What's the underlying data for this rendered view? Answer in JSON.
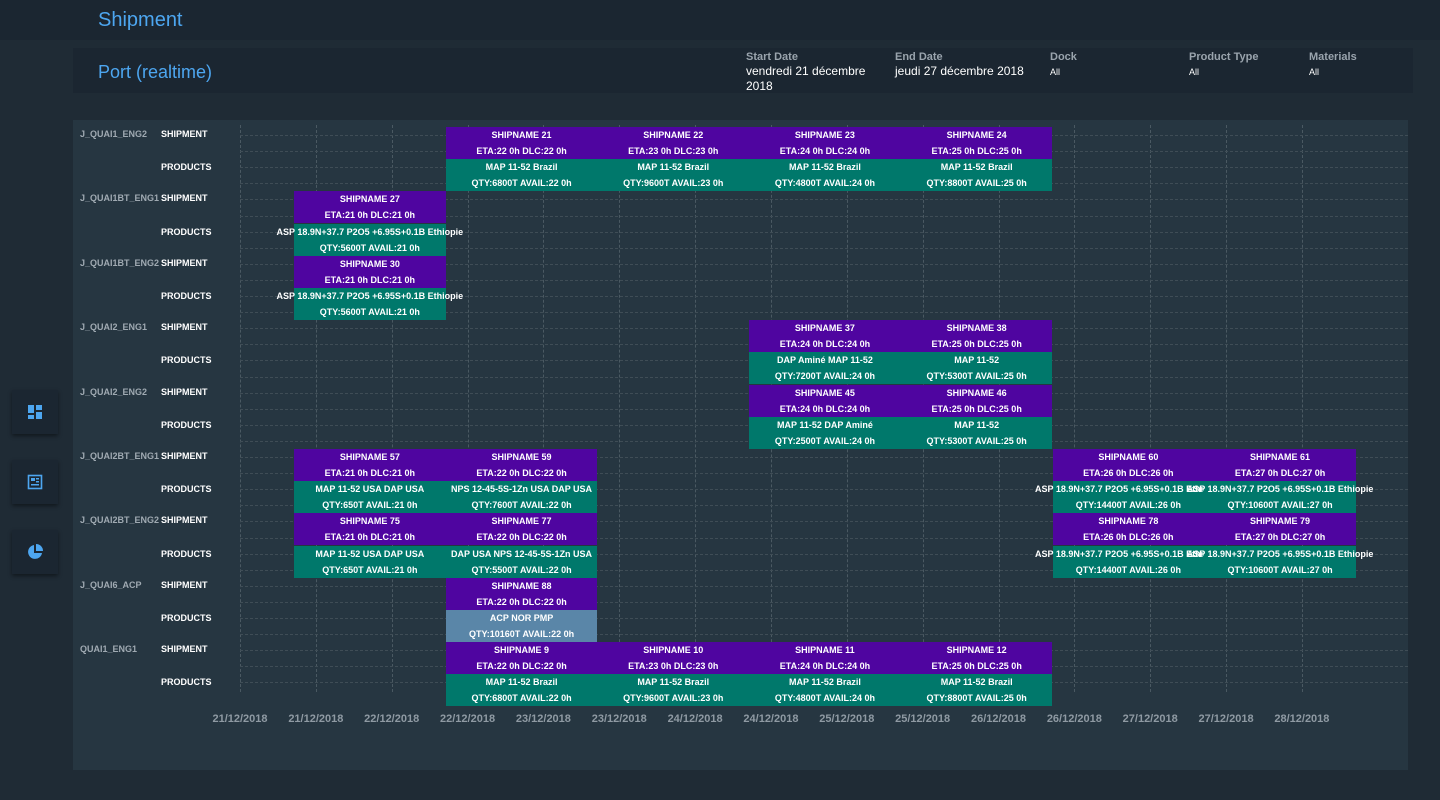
{
  "app": {
    "title": "Shipment"
  },
  "header": {
    "title": "Port (realtime)",
    "filters": {
      "start_date": {
        "label": "Start Date",
        "value": "vendredi 21 décembre 2018"
      },
      "end_date": {
        "label": "End Date",
        "value": "jeudi 27 décembre 2018"
      },
      "dock": {
        "label": "Dock",
        "value": "All"
      },
      "product_type": {
        "label": "Product Type",
        "value": "All"
      },
      "materials": {
        "label": "Materials",
        "value": "All"
      }
    }
  },
  "sidebar": {
    "items": [
      {
        "icon": "dashboard-icon"
      },
      {
        "icon": "report-icon"
      },
      {
        "icon": "pie-chart-icon"
      }
    ]
  },
  "colors": {
    "shipment": "#4f05a0",
    "products": "#00786b",
    "acp": "#5a86a8",
    "accent": "#4da6f0"
  },
  "timeline": {
    "row_labels": {
      "shipment": "SHIPMENT",
      "products": "PRODUCTS"
    },
    "x_ticks": [
      "21/12/2018",
      "21/12/2018",
      "22/12/2018",
      "22/12/2018",
      "23/12/2018",
      "23/12/2018",
      "24/12/2018",
      "24/12/2018",
      "25/12/2018",
      "25/12/2018",
      "26/12/2018",
      "26/12/2018",
      "27/12/2018",
      "27/12/2018",
      "28/12/2018"
    ],
    "docks": [
      {
        "name": "J_QUAI1_ENG2",
        "shipments": [
          {
            "start": 2,
            "end": 3,
            "name": "SHIPNAME 21",
            "eta": "ETA:22 0h DLC:22 0h"
          },
          {
            "start": 3,
            "end": 4,
            "name": "SHIPNAME 22",
            "eta": "ETA:23 0h DLC:23 0h"
          },
          {
            "start": 4,
            "end": 5,
            "name": "SHIPNAME 23",
            "eta": "ETA:24 0h DLC:24 0h"
          },
          {
            "start": 5,
            "end": 6,
            "name": "SHIPNAME 24",
            "eta": "ETA:25 0h DLC:25 0h"
          }
        ],
        "products": [
          {
            "start": 2,
            "end": 3,
            "type": "prod",
            "name": "MAP 11-52  Brazil",
            "qty": "QTY:6800T AVAIL:22 0h"
          },
          {
            "start": 3,
            "end": 4,
            "type": "prod",
            "name": "MAP 11-52  Brazil",
            "qty": "QTY:9600T AVAIL:23 0h"
          },
          {
            "start": 4,
            "end": 5,
            "type": "prod",
            "name": "MAP 11-52  Brazil",
            "qty": "QTY:4800T AVAIL:24 0h"
          },
          {
            "start": 5,
            "end": 6,
            "type": "prod",
            "name": "MAP 11-52  Brazil",
            "qty": "QTY:8800T AVAIL:25 0h"
          }
        ]
      },
      {
        "name": "J_QUAI1BT_ENG1",
        "shipments": [
          {
            "start": 1,
            "end": 2,
            "name": "SHIPNAME 27",
            "eta": "ETA:21 0h DLC:21 0h"
          }
        ],
        "products": [
          {
            "start": 1,
            "end": 2,
            "type": "prod",
            "name": "ASP 18.9N+37.7 P2O5 +6.95S+0.1B  Ethiopie",
            "qty": "QTY:5600T AVAIL:21 0h"
          }
        ]
      },
      {
        "name": "J_QUAI1BT_ENG2",
        "shipments": [
          {
            "start": 1,
            "end": 2,
            "name": "SHIPNAME 30",
            "eta": "ETA:21 0h DLC:21 0h"
          }
        ],
        "products": [
          {
            "start": 1,
            "end": 2,
            "type": "prod",
            "name": "ASP 18.9N+37.7 P2O5 +6.95S+0.1B  Ethiopie",
            "qty": "QTY:5600T AVAIL:21 0h"
          }
        ]
      },
      {
        "name": "J_QUAI2_ENG1",
        "shipments": [
          {
            "start": 4,
            "end": 5,
            "name": "SHIPNAME 37",
            "eta": "ETA:24 0h DLC:24 0h"
          },
          {
            "start": 5,
            "end": 6,
            "name": "SHIPNAME 38",
            "eta": "ETA:25 0h DLC:25 0h"
          }
        ],
        "products": [
          {
            "start": 4,
            "end": 5,
            "type": "prod",
            "name": "DAP Aminé          MAP 11-52",
            "qty": "QTY:7200T AVAIL:24 0h"
          },
          {
            "start": 5,
            "end": 6,
            "type": "prod",
            "name": "MAP 11-52",
            "qty": "QTY:5300T AVAIL:25 0h"
          }
        ]
      },
      {
        "name": "J_QUAI2_ENG2",
        "shipments": [
          {
            "start": 4,
            "end": 5,
            "name": "SHIPNAME 45",
            "eta": "ETA:24 0h DLC:24 0h"
          },
          {
            "start": 5,
            "end": 6,
            "name": "SHIPNAME 46",
            "eta": "ETA:25 0h DLC:25 0h"
          }
        ],
        "products": [
          {
            "start": 4,
            "end": 5,
            "type": "prod",
            "name": "MAP 11-52          DAP Aminé",
            "qty": "QTY:2500T AVAIL:24 0h"
          },
          {
            "start": 5,
            "end": 6,
            "type": "prod",
            "name": "MAP 11-52",
            "qty": "QTY:5300T AVAIL:25 0h"
          }
        ]
      },
      {
        "name": "J_QUAI2BT_ENG1",
        "shipments": [
          {
            "start": 1,
            "end": 2,
            "name": "SHIPNAME 57",
            "eta": "ETA:21 0h DLC:21 0h"
          },
          {
            "start": 2,
            "end": 3,
            "name": "SHIPNAME 59",
            "eta": "ETA:22 0h DLC:22 0h"
          },
          {
            "start": 6,
            "end": 7,
            "name": "SHIPNAME 60",
            "eta": "ETA:26 0h DLC:26 0h"
          },
          {
            "start": 7,
            "end": 8,
            "name": "SHIPNAME 61",
            "eta": "ETA:27 0h DLC:27 0h"
          }
        ],
        "products": [
          {
            "start": 1,
            "end": 2,
            "type": "prod",
            "name": "MAP 11-52 USA        DAP USA",
            "qty": "QTY:650T AVAIL:21 0h"
          },
          {
            "start": 2,
            "end": 3,
            "type": "prod",
            "name": "NPS 12-45-5S-1Zn USA    DAP USA",
            "qty": "QTY:7600T AVAIL:22 0h"
          },
          {
            "start": 6,
            "end": 7,
            "type": "prod",
            "name": "ASP 18.9N+37.7 P2O5 +6.95S+0.1B  Ethiopie",
            "qty": "QTY:14400T AVAIL:26 0h"
          },
          {
            "start": 7,
            "end": 8,
            "type": "prod",
            "name": "ASP 18.9N+37.7 P2O5 +6.95S+0.1B  Ethiopie",
            "qty": "QTY:10600T AVAIL:27 0h"
          }
        ]
      },
      {
        "name": "J_QUAI2BT_ENG2",
        "shipments": [
          {
            "start": 1,
            "end": 2,
            "name": "SHIPNAME 75",
            "eta": "ETA:21 0h DLC:21 0h"
          },
          {
            "start": 2,
            "end": 3,
            "name": "SHIPNAME 77",
            "eta": "ETA:22 0h DLC:22 0h"
          },
          {
            "start": 6,
            "end": 7,
            "name": "SHIPNAME 78",
            "eta": "ETA:26 0h DLC:26 0h"
          },
          {
            "start": 7,
            "end": 8,
            "name": "SHIPNAME 79",
            "eta": "ETA:27 0h DLC:27 0h"
          }
        ],
        "products": [
          {
            "start": 1,
            "end": 2,
            "type": "prod",
            "name": "MAP 11-52 USA        DAP USA",
            "qty": "QTY:650T AVAIL:21 0h"
          },
          {
            "start": 2,
            "end": 3,
            "type": "prod",
            "name": "DAP USA    NPS 12-45-5S-1Zn USA",
            "qty": "QTY:5500T AVAIL:22 0h"
          },
          {
            "start": 6,
            "end": 7,
            "type": "prod",
            "name": "ASP 18.9N+37.7 P2O5 +6.95S+0.1B  Ethiopie",
            "qty": "QTY:14400T AVAIL:26 0h"
          },
          {
            "start": 7,
            "end": 8,
            "type": "prod",
            "name": "ASP 18.9N+37.7 P2O5 +6.95S+0.1B  Ethiopie",
            "qty": "QTY:10600T AVAIL:27 0h"
          }
        ]
      },
      {
        "name": "J_QUAI6_ACP",
        "shipments": [
          {
            "start": 2,
            "end": 3,
            "name": "SHIPNAME 88",
            "eta": "ETA:22 0h DLC:22 0h"
          }
        ],
        "products": [
          {
            "start": 2,
            "end": 3,
            "type": "acp",
            "name": "ACP NOR PMP",
            "qty": "QTY:10160T AVAIL:22 0h"
          }
        ]
      },
      {
        "name": "QUAI1_ENG1",
        "shipments": [
          {
            "start": 2,
            "end": 3,
            "name": "SHIPNAME 9",
            "eta": "ETA:22 0h DLC:22 0h"
          },
          {
            "start": 3,
            "end": 4,
            "name": "SHIPNAME 10",
            "eta": "ETA:23 0h DLC:23 0h"
          },
          {
            "start": 4,
            "end": 5,
            "name": "SHIPNAME 11",
            "eta": "ETA:24 0h DLC:24 0h"
          },
          {
            "start": 5,
            "end": 6,
            "name": "SHIPNAME 12",
            "eta": "ETA:25 0h DLC:25 0h"
          }
        ],
        "products": [
          {
            "start": 2,
            "end": 3,
            "type": "prod",
            "name": "MAP 11-52  Brazil",
            "qty": "QTY:6800T AVAIL:22 0h"
          },
          {
            "start": 3,
            "end": 4,
            "type": "prod",
            "name": "MAP 11-52  Brazil",
            "qty": "QTY:9600T AVAIL:23 0h"
          },
          {
            "start": 4,
            "end": 5,
            "type": "prod",
            "name": "MAP 11-52  Brazil",
            "qty": "QTY:4800T AVAIL:24 0h"
          },
          {
            "start": 5,
            "end": 6,
            "type": "prod",
            "name": "MAP 11-52  Brazil",
            "qty": "QTY:8800T AVAIL:25 0h"
          }
        ]
      }
    ]
  }
}
